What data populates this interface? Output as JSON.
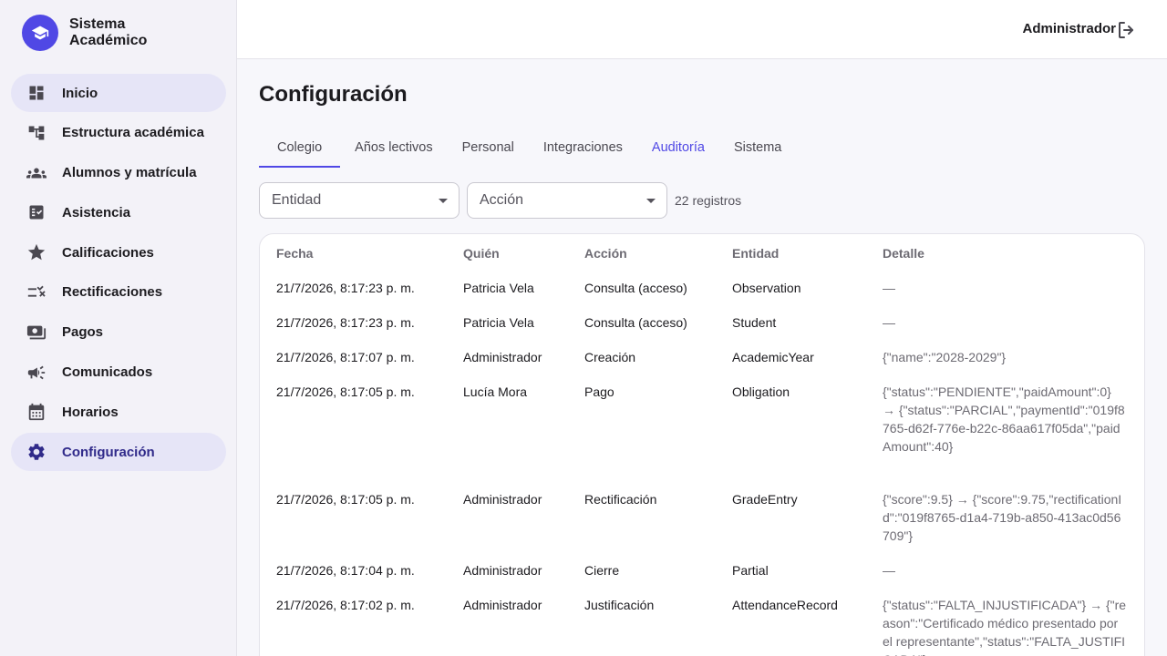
{
  "app": {
    "name": "Sistema Académico"
  },
  "sidebar": {
    "items": [
      {
        "label": "Inicio",
        "icon": "dashboard-icon"
      },
      {
        "label": "Estructura académica",
        "icon": "hierarchy-icon"
      },
      {
        "label": "Alumnos y matrícula",
        "icon": "people-icon"
      },
      {
        "label": "Asistencia",
        "icon": "checklist-icon"
      },
      {
        "label": "Calificaciones",
        "icon": "star-icon"
      },
      {
        "label": "Rectificaciones",
        "icon": "edit-list-icon"
      },
      {
        "label": "Pagos",
        "icon": "payments-icon"
      },
      {
        "label": "Comunicados",
        "icon": "megaphone-icon"
      },
      {
        "label": "Horarios",
        "icon": "calendar-icon"
      },
      {
        "label": "Configuración",
        "icon": "gear-icon"
      }
    ]
  },
  "header": {
    "user": "Administrador"
  },
  "page": {
    "title": "Configuración"
  },
  "tabs": [
    "Colegio",
    "Años lectivos",
    "Personal",
    "Integraciones",
    "Auditoría",
    "Sistema"
  ],
  "filters": {
    "entity": "Entidad",
    "action": "Acción",
    "count": "22 registros"
  },
  "table": {
    "columns": [
      "Fecha",
      "Quién",
      "Acción",
      "Entidad",
      "Detalle"
    ],
    "rows": [
      {
        "date": "21/7/2026, 8:17:23 p. m.",
        "who": "Patricia Vela",
        "action": "Consulta (acceso)",
        "entity": "Observation",
        "detail": "—"
      },
      {
        "date": "21/7/2026, 8:17:23 p. m.",
        "who": "Patricia Vela",
        "action": "Consulta (acceso)",
        "entity": "Student",
        "detail": "—"
      },
      {
        "date": "21/7/2026, 8:17:07 p. m.",
        "who": "Administrador",
        "action": "Creación",
        "entity": "AcademicYear",
        "detail": "{\"name\":\"2028-2029\"}"
      },
      {
        "date": "21/7/2026, 8:17:05 p. m.",
        "who": "Lucía Mora",
        "action": "Pago",
        "entity": "Obligation",
        "detail": "{\"status\":\"PENDIENTE\",\"paidAmount\":0} → {\"status\":\"PARCIAL\",\"paymentId\":\"019f8765-d62f-776e-b22c-86aa617f05da\",\"paidAmount\":40}"
      },
      {
        "date": "21/7/2026, 8:17:05 p. m.",
        "who": "Administrador",
        "action": "Rectificación",
        "entity": "GradeEntry",
        "detail": "{\"score\":9.5} → {\"score\":9.75,\"rectificationId\":\"019f8765-d1a4-719b-a850-413ac0d56709\"}"
      },
      {
        "date": "21/7/2026, 8:17:04 p. m.",
        "who": "Administrador",
        "action": "Cierre",
        "entity": "Partial",
        "detail": "—"
      },
      {
        "date": "21/7/2026, 8:17:02 p. m.",
        "who": "Administrador",
        "action": "Justificación",
        "entity": "AttendanceRecord",
        "detail": "{\"status\":\"FALTA_INJUSTIFICADA\"} → {\"reason\":\"Certificado médico presentado por el representante\",\"status\":\"FALTA_JUSTIFICADA\"}"
      }
    ]
  },
  "colors": {
    "accent": "#5048e5",
    "activeNavBg": "#e6e5f7",
    "activeText": "#302a8a"
  }
}
